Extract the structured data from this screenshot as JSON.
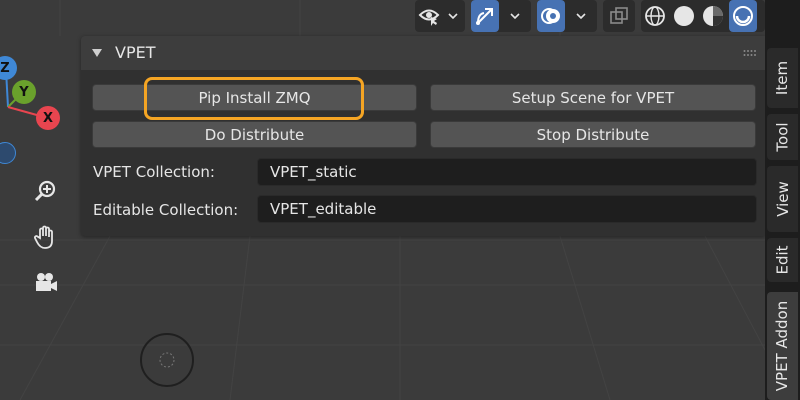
{
  "panel": {
    "title": "VPET",
    "buttons": {
      "pip_install": "Pip Install ZMQ",
      "setup_scene": "Setup Scene for VPET",
      "do_distribute": "Do Distribute",
      "stop_distribute": "Stop Distribute"
    },
    "fields": {
      "collection_label": "VPET Collection:",
      "collection_value": "VPET_static",
      "editable_label": "Editable Collection:",
      "editable_value": "VPET_editable"
    }
  },
  "gizmo": {
    "z": "Z",
    "y": "Y",
    "x": "X"
  },
  "sidebar_tabs": [
    "Item",
    "Tool",
    "View",
    "Edit",
    "VPET Addon"
  ],
  "colors": {
    "highlight": "#f5a524",
    "active_blue": "#4772b3",
    "x_axis": "#e8454f",
    "y_axis": "#6aa12c",
    "z_axis": "#3f88d6"
  }
}
